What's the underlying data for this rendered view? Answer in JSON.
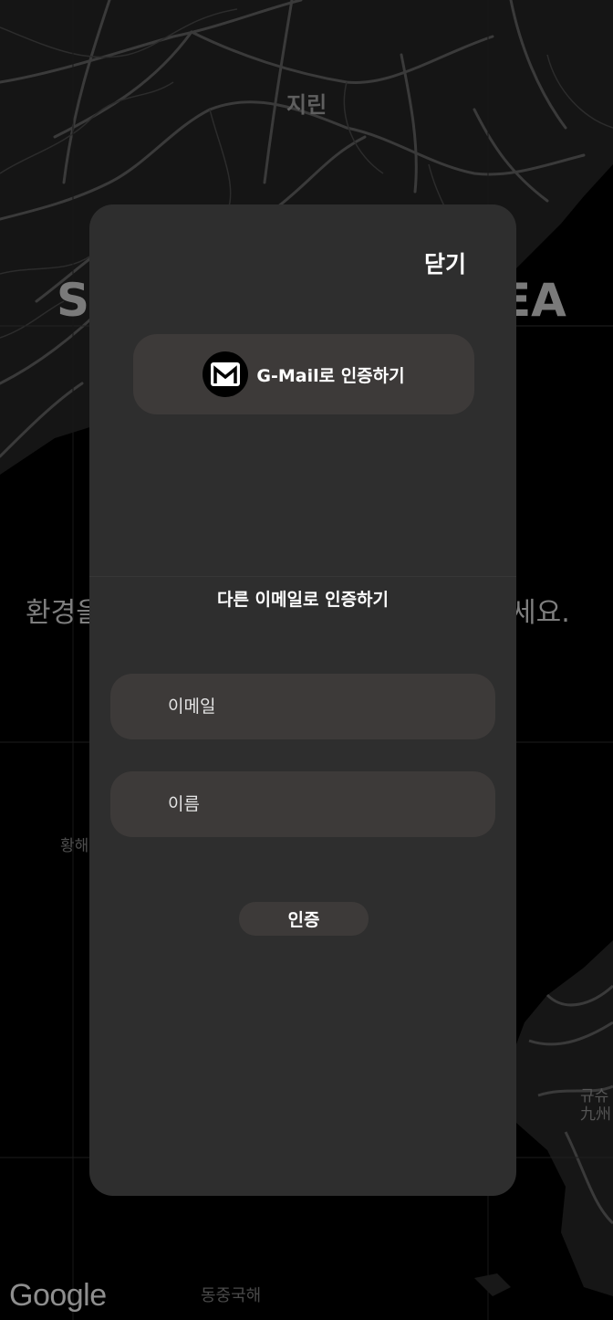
{
  "map": {
    "labels": {
      "jilin": "지린",
      "yellow_sea": "황해",
      "east_china_sea": "동중국해",
      "kyushu_ko": "규슈",
      "kyushu_ja": "九州"
    },
    "background_text": {
      "title_left": "SE",
      "title_right": "EA",
      "line_left": "환경을",
      "line_right": "세요."
    },
    "attribution": "Google"
  },
  "modal": {
    "close_label": "닫기",
    "gmail_button_label": "G-Mail로 인증하기",
    "gmail_icon": "gmail-icon",
    "section_title": "다른 이메일로 인증하기",
    "email_placeholder": "이메일",
    "name_placeholder": "이름",
    "verify_label": "인증"
  },
  "colors": {
    "modal_background": "#2e2e2e",
    "field_background": "#3d3a39",
    "map_background": "#000000",
    "map_roads": "#3a3a3a",
    "text": "#ffffff"
  }
}
